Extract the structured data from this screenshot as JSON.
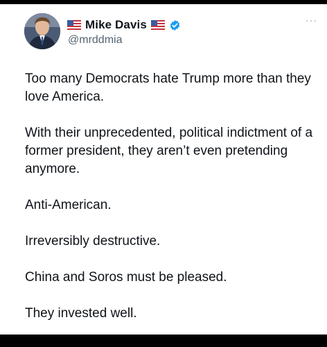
{
  "tweet": {
    "author": {
      "display_name": "Mike Davis",
      "handle": "@mrddmia",
      "verified": true,
      "flag_icon": "us-flag-icon"
    },
    "more_label": "···",
    "paragraphs": [
      "Too many Democrats hate Trump more than they love America.",
      "With their unprecedented, political indictment of a former president, they aren’t even pretending anymore.",
      "Anti-American.",
      "Irreversibly destructive.",
      "China and Soros must be pleased.",
      "They invested well."
    ]
  },
  "colors": {
    "background": "#000000",
    "card": "#ffffff",
    "text": "#0f1419",
    "secondary": "#536471",
    "verified": "#1d9bf0"
  }
}
